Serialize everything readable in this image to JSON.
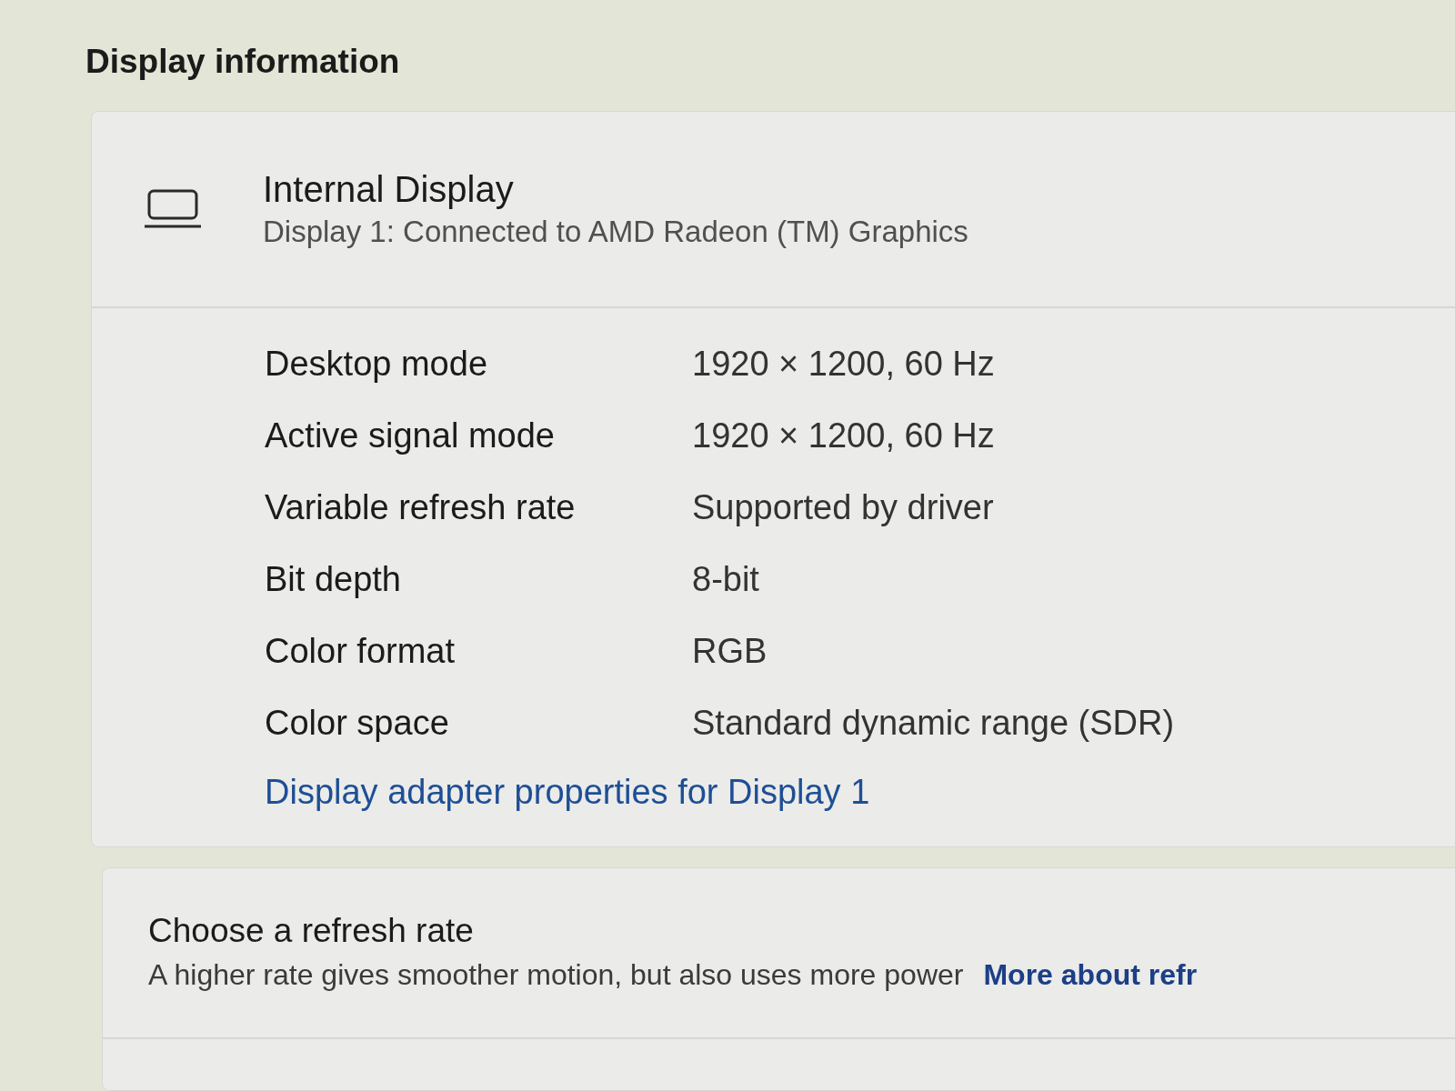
{
  "section_title": "Display information",
  "display_card": {
    "name": "Internal Display",
    "description": "Display 1: Connected to AMD Radeon (TM) Graphics",
    "properties": [
      {
        "label": "Desktop mode",
        "value": "1920 × 1200, 60 Hz"
      },
      {
        "label": "Active signal mode",
        "value": "1920 × 1200, 60 Hz"
      },
      {
        "label": "Variable refresh rate",
        "value": "Supported by driver"
      },
      {
        "label": "Bit depth",
        "value": "8-bit"
      },
      {
        "label": "Color format",
        "value": "RGB"
      },
      {
        "label": "Color space",
        "value": "Standard dynamic range (SDR)"
      }
    ],
    "link": "Display adapter properties for Display 1"
  },
  "refresh_rate_card": {
    "title": "Choose a refresh rate",
    "description": "A higher rate gives smoother motion, but also uses more power",
    "link": "More about refr"
  }
}
